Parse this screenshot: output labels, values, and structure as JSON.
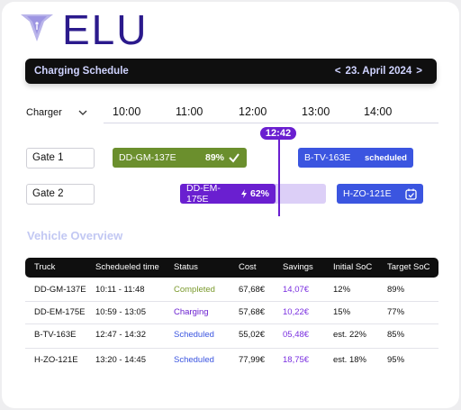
{
  "brand": {
    "name": "ELU",
    "logo_icon": "manta-ray-logo"
  },
  "header": {
    "title": "Charging Schedule",
    "prev": "<",
    "date": "23. April 2024",
    "next": ">"
  },
  "schedule": {
    "charger_label": "Charger",
    "times": [
      "10:00",
      "11:00",
      "12:00",
      "13:00",
      "14:00"
    ],
    "current_time": "12:42",
    "gates": [
      {
        "label": "Gate 1"
      },
      {
        "label": "Gate 2"
      }
    ],
    "slots": {
      "gm137": {
        "truck": "DD-GM-137E",
        "pct": "89%",
        "icon": "checkmark-icon"
      },
      "tv163": {
        "truck": "B-TV-163E",
        "status": "scheduled"
      },
      "em175": {
        "truck": "DD-EM-175E",
        "pct": "62%",
        "icon": "lightning-icon"
      },
      "zo121": {
        "truck": "H-ZO-121E",
        "icon": "calendar-check-icon"
      }
    }
  },
  "overview": {
    "title": "Vehicle Overview",
    "columns": [
      "Truck",
      "Schedueled time",
      "Status",
      "Cost",
      "Savings",
      "Initial SoC",
      "Target SoC"
    ],
    "rows": [
      {
        "truck": "DD-GM-137E",
        "time": "10:11 - 11:48",
        "status": "Completed",
        "cost": "67,68€",
        "savings": "14,07€",
        "initial": "12%",
        "target": "89%"
      },
      {
        "truck": "DD-EM-175E",
        "time": "10:59 - 13:05",
        "status": "Charging",
        "cost": "57,68€",
        "savings": "10,22€",
        "initial": "15%",
        "target": "77%"
      },
      {
        "truck": "B-TV-163E",
        "time": "12:47 - 14:32",
        "status": "Scheduled",
        "cost": "55,02€",
        "savings": "05,48€",
        "initial": "est. 22%",
        "target": "85%"
      },
      {
        "truck": "H-ZO-121E",
        "time": "13:20 - 14:45",
        "status": "Scheduled",
        "cost": "77,99€",
        "savings": "18,75€",
        "initial": "est. 18%",
        "target": "95%"
      }
    ]
  },
  "colors": {
    "brand_text": "#2b1a8c",
    "completed": "#6b8f2d",
    "charging": "#6a1fd0",
    "scheduled": "#3b55e0",
    "header_bg": "#0f0f0f"
  }
}
